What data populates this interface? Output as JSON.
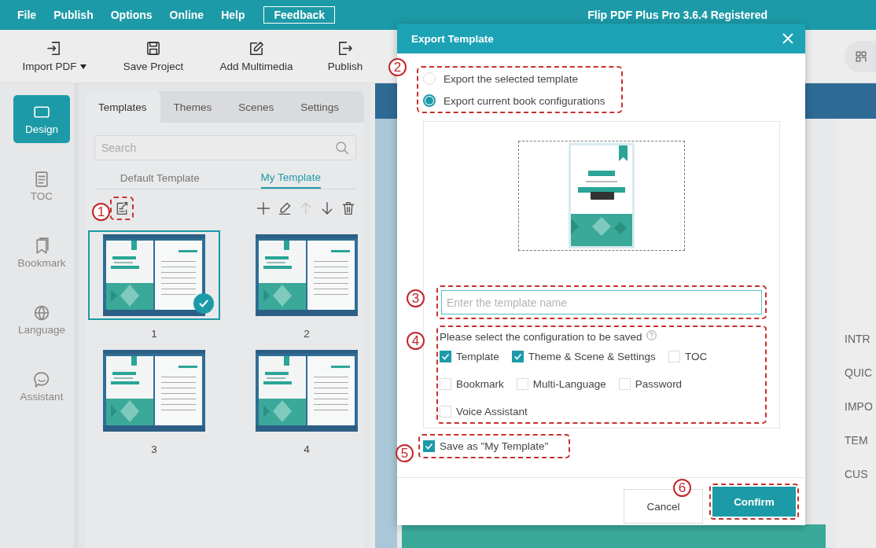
{
  "menu_bar": {
    "items": [
      "File",
      "Publish",
      "Options",
      "Online",
      "Help"
    ],
    "feedback": "Feedback",
    "app_title": "Flip PDF Plus Pro 3.6.4 Registered"
  },
  "toolbar": [
    {
      "label": "Import PDF",
      "dropdown": true
    },
    {
      "label": "Save Project",
      "dropdown": false
    },
    {
      "label": "Add Multimedia",
      "dropdown": false
    },
    {
      "label": "Publish",
      "dropdown": false
    }
  ],
  "side_nav": [
    {
      "label": "Design",
      "selected": true
    },
    {
      "label": "TOC",
      "selected": false
    },
    {
      "label": "Bookmark",
      "selected": false
    },
    {
      "label": "Language",
      "selected": false
    },
    {
      "label": "Assistant",
      "selected": false
    }
  ],
  "panel": {
    "tabs": [
      {
        "label": "Templates",
        "selected": true
      },
      {
        "label": "Themes",
        "selected": false
      },
      {
        "label": "Scenes",
        "selected": false
      },
      {
        "label": "Settings",
        "selected": false
      }
    ],
    "search": {
      "placeholder": "Search"
    },
    "subtabs": [
      {
        "label": "Default Template",
        "selected": false
      },
      {
        "label": "My Template",
        "selected": true
      }
    ],
    "tools": [
      {
        "disabled": false
      },
      {
        "disabled": false
      },
      {
        "disabled": true
      },
      {
        "disabled": false
      },
      {
        "disabled": false
      }
    ],
    "templates": [
      {
        "label": "1",
        "selected": true
      },
      {
        "label": "2",
        "selected": false
      },
      {
        "label": "3",
        "selected": false
      },
      {
        "label": "4",
        "selected": false
      }
    ]
  },
  "outline": [
    "INTR",
    "QUIC",
    "IMPO",
    "TEM",
    "CUS"
  ],
  "dialog": {
    "title": "Export Template",
    "export_options": [
      {
        "label": "Export the selected template",
        "selected": false
      },
      {
        "label": "Export current book configurations",
        "selected": true
      }
    ],
    "name_field": {
      "placeholder": "Enter the template name"
    },
    "config_prompt": "Please select the configuration to be saved",
    "configs": [
      {
        "label": "Template",
        "checked": true
      },
      {
        "label": "Theme & Scene & Settings",
        "checked": true
      },
      {
        "label": "TOC",
        "checked": false
      },
      {
        "label": "Bookmark",
        "checked": false
      },
      {
        "label": "Multi-Language",
        "checked": false
      },
      {
        "label": "Password",
        "checked": false
      },
      {
        "label": "Voice Assistant",
        "checked": false
      }
    ],
    "save_as": {
      "label": "Save as \"My Template\"",
      "checked": true
    },
    "buttons": [
      {
        "label": "Cancel",
        "kind": "secondary"
      },
      {
        "label": "Confirm",
        "kind": "primary"
      }
    ]
  },
  "annotations": [
    "1",
    "2",
    "3",
    "4",
    "5",
    "6"
  ]
}
